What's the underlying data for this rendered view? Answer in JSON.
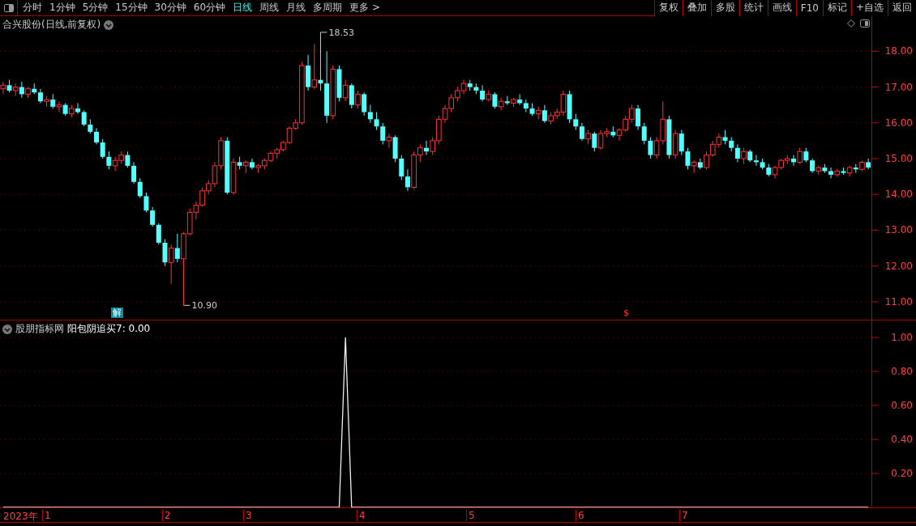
{
  "toolbar": {
    "periods": [
      {
        "label": "分时",
        "selected": false
      },
      {
        "label": "1分钟",
        "selected": false
      },
      {
        "label": "5分钟",
        "selected": false
      },
      {
        "label": "15分钟",
        "selected": false
      },
      {
        "label": "30分钟",
        "selected": false
      },
      {
        "label": "60分钟",
        "selected": false
      },
      {
        "label": "日线",
        "selected": true
      },
      {
        "label": "周线",
        "selected": false
      },
      {
        "label": "月线",
        "selected": false
      },
      {
        "label": "多周期",
        "selected": false
      },
      {
        "label": "更多 >",
        "selected": false
      }
    ],
    "actions": [
      "复权",
      "叠加",
      "多股",
      "统计",
      "画线",
      "F10",
      "标记",
      "+自选",
      "返回"
    ]
  },
  "main_pane": {
    "title": "合兴股份(日线,前复权)",
    "high_label": "18.53",
    "low_label": "10.90",
    "markers": [
      {
        "text": "解",
        "kind": "box"
      },
      {
        "text": "$",
        "kind": "plain"
      }
    ],
    "chart_data": {
      "type": "candlestick",
      "ylim": [
        10.5,
        18.98
      ],
      "grid": true,
      "yticks": [
        {
          "value": 18,
          "label": "18.00"
        },
        {
          "value": 17,
          "label": "17.00"
        },
        {
          "value": 16,
          "label": "16.00"
        },
        {
          "value": 15,
          "label": "15.00"
        },
        {
          "value": 14,
          "label": "14.00"
        },
        {
          "value": 13,
          "label": "13.00"
        },
        {
          "value": 12,
          "label": "12.00"
        },
        {
          "value": 11,
          "label": "11.00"
        }
      ],
      "ohlc": [
        [
          16.95,
          17.15,
          16.8,
          17.05
        ],
        [
          17.05,
          17.2,
          16.85,
          16.9
        ],
        [
          16.9,
          17.1,
          16.75,
          17.0
        ],
        [
          17.0,
          17.15,
          16.7,
          16.8
        ],
        [
          16.8,
          17.0,
          16.7,
          16.95
        ],
        [
          16.95,
          17.1,
          16.8,
          16.85
        ],
        [
          16.85,
          16.95,
          16.55,
          16.6
        ],
        [
          16.6,
          16.75,
          16.45,
          16.65
        ],
        [
          16.65,
          16.8,
          16.4,
          16.45
        ],
        [
          16.45,
          16.6,
          16.3,
          16.5
        ],
        [
          16.5,
          16.55,
          16.2,
          16.25
        ],
        [
          16.25,
          16.5,
          16.15,
          16.4
        ],
        [
          16.4,
          16.55,
          16.25,
          16.3
        ],
        [
          16.3,
          16.35,
          15.9,
          15.95
        ],
        [
          15.95,
          16.1,
          15.7,
          15.75
        ],
        [
          15.75,
          15.85,
          15.4,
          15.45
        ],
        [
          15.45,
          15.55,
          15.0,
          15.05
        ],
        [
          15.05,
          15.2,
          14.7,
          14.8
        ],
        [
          14.8,
          15.05,
          14.65,
          14.95
        ],
        [
          14.95,
          15.2,
          14.85,
          15.1
        ],
        [
          15.1,
          15.2,
          14.75,
          14.8
        ],
        [
          14.8,
          14.9,
          14.3,
          14.35
        ],
        [
          14.35,
          14.45,
          13.9,
          13.95
        ],
        [
          13.95,
          14.05,
          13.5,
          13.55
        ],
        [
          13.55,
          13.65,
          13.1,
          13.15
        ],
        [
          13.15,
          13.2,
          12.6,
          12.65
        ],
        [
          12.65,
          12.75,
          12.0,
          12.1
        ],
        [
          12.1,
          12.6,
          11.5,
          12.5
        ],
        [
          12.5,
          12.9,
          12.1,
          12.2
        ],
        [
          12.2,
          12.95,
          10.9,
          12.9
        ],
        [
          12.9,
          13.6,
          12.85,
          13.5
        ],
        [
          13.5,
          13.8,
          13.3,
          13.7
        ],
        [
          13.7,
          14.2,
          13.65,
          14.1
        ],
        [
          14.1,
          14.4,
          14.0,
          14.3
        ],
        [
          14.3,
          14.9,
          14.2,
          14.8
        ],
        [
          14.8,
          15.6,
          14.7,
          15.5
        ],
        [
          15.5,
          15.6,
          14.0,
          14.05
        ],
        [
          14.05,
          15.0,
          14.0,
          14.9
        ],
        [
          14.9,
          15.05,
          14.7,
          14.8
        ],
        [
          14.8,
          14.95,
          14.6,
          14.9
        ],
        [
          14.9,
          15.0,
          14.7,
          14.75
        ],
        [
          14.75,
          14.85,
          14.6,
          14.8
        ],
        [
          14.8,
          15.0,
          14.7,
          14.95
        ],
        [
          14.95,
          15.2,
          14.9,
          15.15
        ],
        [
          15.15,
          15.3,
          15.0,
          15.25
        ],
        [
          15.25,
          15.5,
          15.2,
          15.45
        ],
        [
          15.45,
          15.9,
          15.4,
          15.85
        ],
        [
          15.85,
          16.1,
          15.8,
          16.0
        ],
        [
          16.0,
          17.7,
          15.95,
          17.6
        ],
        [
          17.6,
          17.9,
          16.9,
          17.0
        ],
        [
          17.0,
          18.2,
          16.95,
          17.2
        ],
        [
          17.2,
          18.53,
          16.9,
          17.1
        ],
        [
          17.1,
          18.0,
          16.0,
          16.2
        ],
        [
          16.2,
          17.6,
          16.1,
          17.5
        ],
        [
          17.5,
          17.6,
          16.6,
          16.7
        ],
        [
          16.7,
          17.2,
          16.6,
          17.05
        ],
        [
          17.05,
          17.1,
          16.4,
          16.5
        ],
        [
          16.5,
          16.9,
          16.4,
          16.8
        ],
        [
          16.8,
          16.85,
          16.2,
          16.3
        ],
        [
          16.3,
          16.5,
          16.0,
          16.1
        ],
        [
          16.1,
          16.3,
          15.8,
          15.9
        ],
        [
          15.9,
          16.0,
          15.4,
          15.5
        ],
        [
          15.5,
          15.7,
          15.3,
          15.6
        ],
        [
          15.6,
          15.65,
          14.9,
          15.0
        ],
        [
          15.0,
          15.1,
          14.4,
          14.5
        ],
        [
          14.5,
          14.7,
          14.1,
          14.2
        ],
        [
          14.2,
          15.2,
          14.15,
          15.1
        ],
        [
          15.1,
          15.4,
          14.9,
          15.3
        ],
        [
          15.3,
          15.5,
          15.1,
          15.2
        ],
        [
          15.2,
          15.6,
          15.1,
          15.5
        ],
        [
          15.5,
          16.2,
          15.4,
          16.1
        ],
        [
          16.1,
          16.5,
          16.0,
          16.4
        ],
        [
          16.4,
          16.8,
          16.3,
          16.7
        ],
        [
          16.7,
          17.0,
          16.6,
          16.9
        ],
        [
          16.9,
          17.2,
          16.8,
          17.1
        ],
        [
          17.1,
          17.2,
          16.9,
          17.0
        ],
        [
          17.0,
          17.1,
          16.8,
          16.9
        ],
        [
          16.9,
          17.05,
          16.6,
          16.65
        ],
        [
          16.65,
          16.9,
          16.6,
          16.8
        ],
        [
          16.8,
          16.85,
          16.4,
          16.45
        ],
        [
          16.45,
          16.7,
          16.35,
          16.6
        ],
        [
          16.6,
          16.75,
          16.5,
          16.55
        ],
        [
          16.55,
          16.7,
          16.45,
          16.65
        ],
        [
          16.65,
          16.8,
          16.5,
          16.55
        ],
        [
          16.55,
          16.65,
          16.3,
          16.4
        ],
        [
          16.4,
          16.55,
          16.2,
          16.25
        ],
        [
          16.25,
          16.45,
          16.1,
          16.35
        ],
        [
          16.35,
          16.5,
          16.0,
          16.05
        ],
        [
          16.05,
          16.3,
          15.95,
          16.2
        ],
        [
          16.2,
          16.4,
          16.1,
          16.3
        ],
        [
          16.3,
          16.9,
          16.2,
          16.8
        ],
        [
          16.8,
          16.9,
          16.0,
          16.1
        ],
        [
          16.1,
          16.25,
          15.8,
          15.9
        ],
        [
          15.9,
          16.0,
          15.5,
          15.55
        ],
        [
          15.55,
          15.8,
          15.4,
          15.7
        ],
        [
          15.7,
          15.75,
          15.2,
          15.3
        ],
        [
          15.3,
          15.8,
          15.25,
          15.7
        ],
        [
          15.7,
          15.85,
          15.6,
          15.75
        ],
        [
          15.75,
          15.9,
          15.6,
          15.65
        ],
        [
          15.65,
          15.85,
          15.5,
          15.8
        ],
        [
          15.8,
          16.2,
          15.75,
          16.1
        ],
        [
          16.1,
          16.5,
          16.0,
          16.4
        ],
        [
          16.4,
          16.5,
          15.8,
          15.9
        ],
        [
          15.9,
          16.0,
          15.4,
          15.5
        ],
        [
          15.5,
          15.6,
          15.0,
          15.1
        ],
        [
          15.1,
          15.6,
          15.0,
          15.5
        ],
        [
          15.5,
          16.6,
          15.4,
          16.1
        ],
        [
          16.1,
          16.2,
          15.0,
          15.1
        ],
        [
          15.1,
          15.8,
          15.0,
          15.7
        ],
        [
          15.7,
          15.8,
          15.1,
          15.2
        ],
        [
          15.2,
          15.3,
          14.7,
          14.8
        ],
        [
          14.8,
          14.95,
          14.6,
          14.9
        ],
        [
          14.9,
          15.0,
          14.7,
          14.75
        ],
        [
          14.75,
          15.2,
          14.7,
          15.1
        ],
        [
          15.1,
          15.5,
          15.05,
          15.4
        ],
        [
          15.4,
          15.7,
          15.3,
          15.6
        ],
        [
          15.6,
          15.8,
          15.4,
          15.5
        ],
        [
          15.5,
          15.6,
          15.2,
          15.3
        ],
        [
          15.3,
          15.4,
          14.9,
          15.0
        ],
        [
          15.0,
          15.3,
          14.85,
          15.2
        ],
        [
          15.2,
          15.25,
          14.9,
          14.95
        ],
        [
          14.95,
          15.1,
          14.8,
          14.9
        ],
        [
          14.9,
          15.0,
          14.7,
          14.75
        ],
        [
          14.75,
          14.85,
          14.5,
          14.55
        ],
        [
          14.55,
          14.8,
          14.45,
          14.75
        ],
        [
          14.75,
          15.0,
          14.7,
          14.95
        ],
        [
          14.95,
          15.1,
          14.85,
          15.0
        ],
        [
          15.0,
          15.1,
          14.8,
          14.9
        ],
        [
          14.9,
          15.3,
          14.85,
          15.2
        ],
        [
          15.2,
          15.3,
          14.9,
          14.95
        ],
        [
          14.95,
          15.0,
          14.6,
          14.65
        ],
        [
          14.65,
          14.8,
          14.55,
          14.75
        ],
        [
          14.75,
          14.85,
          14.6,
          14.65
        ],
        [
          14.65,
          14.75,
          14.45,
          14.55
        ],
        [
          14.55,
          14.7,
          14.5,
          14.65
        ],
        [
          14.65,
          14.75,
          14.55,
          14.6
        ],
        [
          14.6,
          14.8,
          14.5,
          14.75
        ],
        [
          14.75,
          14.85,
          14.6,
          14.7
        ],
        [
          14.7,
          14.95,
          14.65,
          14.9
        ],
        [
          14.9,
          15.0,
          14.7,
          14.75
        ]
      ]
    }
  },
  "indicator_pane": {
    "source": "股朋指标网",
    "reading": ": 0.00",
    "chart_data": {
      "type": "line",
      "ylim": [
        0,
        1.1
      ],
      "grid": true,
      "yticks": [
        {
          "value": 1,
          "label": "1.00"
        },
        {
          "value": 0.8,
          "label": "0.80"
        },
        {
          "value": 0.6,
          "label": "0.60"
        },
        {
          "value": 0.4,
          "label": "0.40"
        },
        {
          "value": 0.2,
          "label": "0.20"
        }
      ],
      "series": [
        {
          "name": "阳包阴追买7",
          "color": "#eeeeee",
          "values": [
            0,
            0,
            0,
            0,
            0,
            0,
            0,
            0,
            0,
            0,
            0,
            0,
            0,
            0,
            0,
            0,
            0,
            0,
            0,
            0,
            0,
            0,
            0,
            0,
            0,
            0,
            0,
            0,
            0,
            0,
            0,
            0,
            0,
            0,
            0,
            0,
            0,
            0,
            0,
            0,
            0,
            0,
            0,
            0,
            0,
            0,
            0,
            0,
            0,
            0,
            0,
            0,
            0,
            0,
            0,
            1,
            0,
            0,
            0,
            0,
            0,
            0,
            0,
            0,
            0,
            0,
            0,
            0,
            0,
            0,
            0,
            0,
            0,
            0,
            0,
            0,
            0,
            0,
            0,
            0,
            0,
            0,
            0,
            0,
            0,
            0,
            0,
            0,
            0,
            0,
            0,
            0,
            0,
            0,
            0,
            0,
            0,
            0,
            0,
            0,
            0,
            0,
            0,
            0,
            0,
            0,
            0,
            0,
            0,
            0,
            0,
            0,
            0,
            0,
            0,
            0,
            0,
            0,
            0,
            0,
            0,
            0,
            0,
            0,
            0,
            0,
            0,
            0,
            0,
            0,
            0,
            0,
            0,
            0,
            0,
            0,
            0,
            0,
            0,
            0
          ]
        }
      ]
    }
  },
  "date_axis": {
    "year": "2023年",
    "months": [
      "1",
      "2",
      "3",
      "4",
      "5",
      "6",
      "7"
    ]
  }
}
